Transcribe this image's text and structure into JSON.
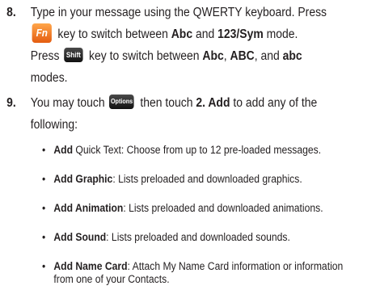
{
  "step8": {
    "number": "8.",
    "line1": "Type in your message using the QWERTY keyboard. Press",
    "fn_key": "Fn",
    "line2_a": " key to switch between ",
    "abc": "Abc",
    "and1": " and ",
    "sym": "123/Sym",
    "mode": " mode.",
    "press": "Press ",
    "shift_key": "Shift",
    "line3_a": " key to switch between ",
    "abc2": "Abc",
    "comma": ", ",
    "ABC": "ABC",
    "and2": ", and ",
    "abc_lower": "abc",
    "modes": "modes."
  },
  "step9": {
    "number": "9.",
    "you_may": "You may touch ",
    "options_key": "Options",
    "then_touch": " then touch ",
    "add_item": "2. Add",
    "rest": " to add any of the",
    "following": "following:"
  },
  "bullets": [
    {
      "bold": "Add",
      "text": " Quick Text: Choose from up to 12 pre-loaded messages."
    },
    {
      "bold": "Add Graphic",
      "text": ": Lists preloaded and downloaded graphics."
    },
    {
      "bold": "Add Animation",
      "text": ": Lists preloaded and downloaded animations."
    },
    {
      "bold": "Add Sound",
      "text": ": Lists preloaded and downloaded sounds."
    },
    {
      "bold": "Add Name Card",
      "text": ": Attach My Name Card information or information",
      "line2": "from one of your Contacts."
    }
  ],
  "bullet_glyph": "•"
}
